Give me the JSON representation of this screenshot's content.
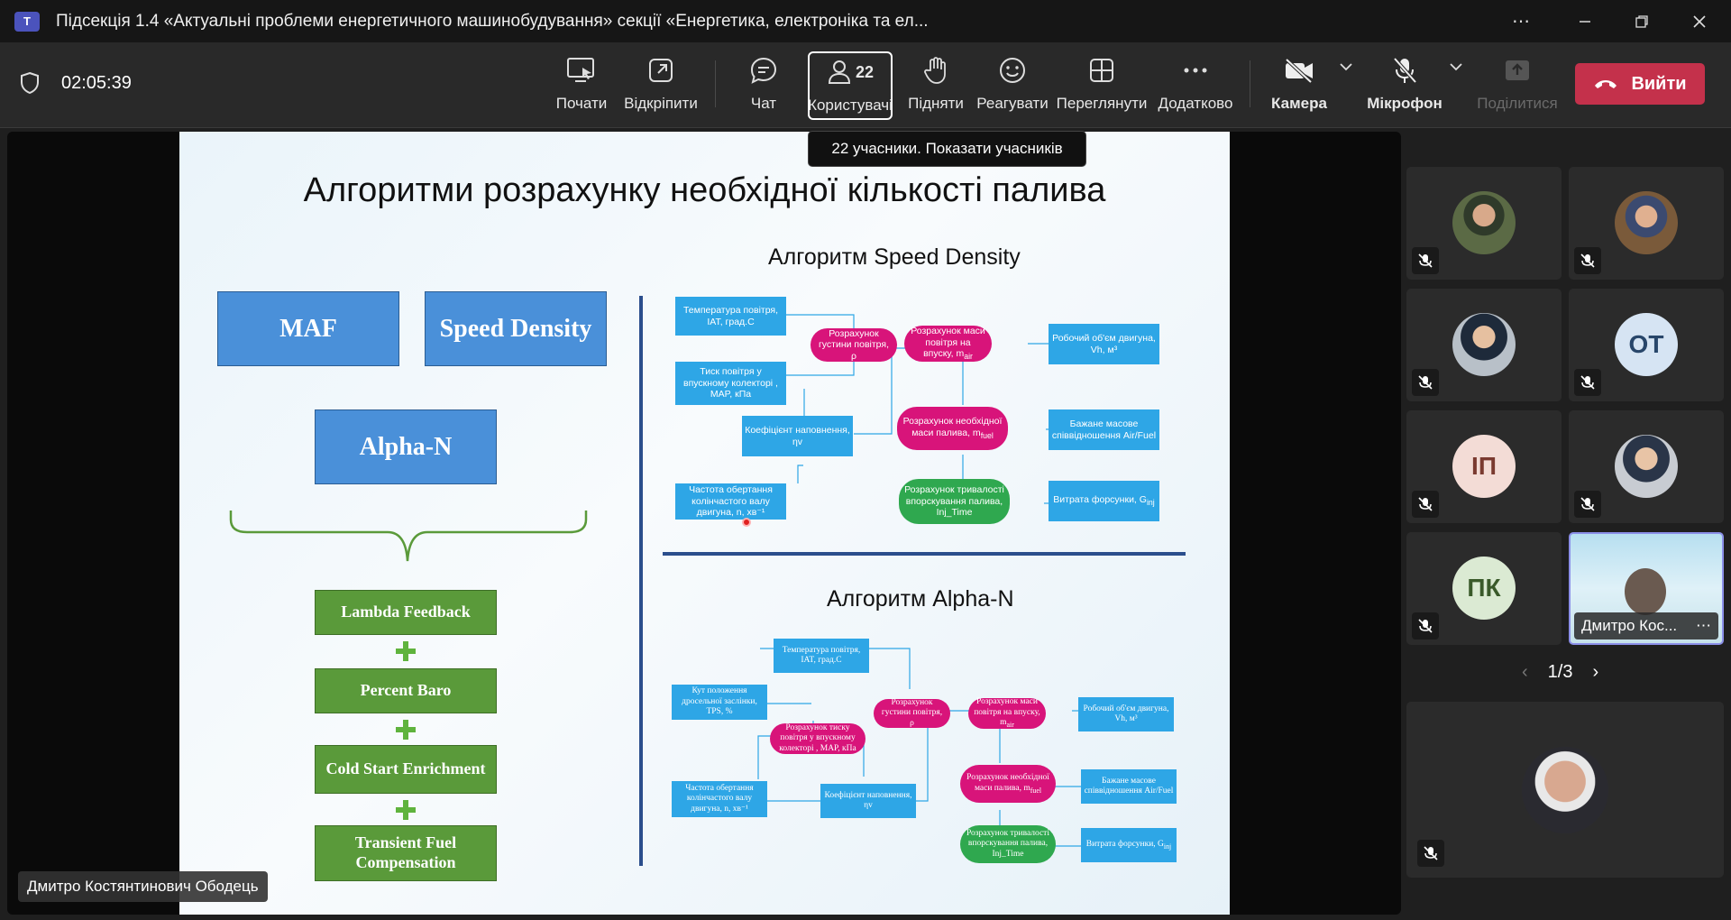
{
  "window": {
    "title": "Підсекція 1.4 «Актуальні проблеми енергетичного машинобудування» секції «Енергетика, електроніка та ел...",
    "app_logo": "T"
  },
  "meeting": {
    "timer": "02:05:39",
    "participant_count": "22",
    "tooltip": "22 учасники. Показати учасників"
  },
  "toolbar": {
    "start": "Почати",
    "popout": "Відкріпити",
    "chat": "Чат",
    "people": "Користувачі",
    "raise": "Підняти",
    "react": "Реагувати",
    "view": "Переглянути",
    "more": "Додатково",
    "camera": "Камера",
    "mic": "Мікрофон",
    "share": "Поділитися",
    "leave": "Вийти"
  },
  "slide": {
    "title": "Алгоритми розрахунку необхідної кількості палива",
    "boxes": {
      "maf": "MAF",
      "speed_density": "Speed Density",
      "alpha_n": "Alpha-N"
    },
    "corrections": [
      "Lambda Feedback",
      "Percent Baro",
      "Cold Start Enrichment",
      "Transient Fuel Compensation"
    ],
    "sd": {
      "title": "Алгоритм Speed Density",
      "temp": "Температура повітря, IAT, град.С",
      "pressure": "Тиск повітря у впускному колекторі , MAP, кПа",
      "rpm": "Частота обертання колінчастого валу двигуна, n, хв⁻¹",
      "density": "Розрахунок густини повітря, ρ",
      "efficiency": "Коефіцієнт наповнення, ηv",
      "air_mass": "Розрахунок маси повітря на впуску, m",
      "air_mass_sub": "air",
      "volume": "Робочий об'єм двигуна, Vh, м³",
      "fuel_mass": "Розрахунок необхідної маси палива, m",
      "fuel_mass_sub": "fuel",
      "afr": "Бажане масове співвідношення Air/Fuel",
      "inj_time": "Розрахунок тривалості впорскування палива, Inj_Time",
      "injector": "Витрата форсунки, G",
      "injector_sub": "inj"
    },
    "an": {
      "title": "Алгоритм Alpha-N",
      "temp": "Температура повітря, IAT, град.С",
      "tps": "Кут положення дросельної заслінки, TPS, %",
      "map_calc": "Розрахунок тиску повітря у впускному колекторі , MAP, кПа",
      "rpm": "Частота обертання колінчастого валу двигуна, n, хв⁻¹",
      "density": "Розрахунок густини повітря, ρ",
      "efficiency": "Коефіцієнт наповнення, ηv",
      "air_mass": "Розрахунок маси повітря на впуску, m",
      "air_mass_sub": "air",
      "volume": "Робочий об'єм двигуна, Vh, м³",
      "fuel_mass": "Розрахунок необхідної маси палива, m",
      "fuel_mass_sub": "fuel",
      "afr": "Бажане масове співвідношення Air/Fuel",
      "inj_time": "Розрахунок тривалості впорскування палива, Inj_Time",
      "injector": "Витрата форсунки, G",
      "injector_sub": "inj"
    }
  },
  "presenter_name": "Дмитро Костянтинович Ободець",
  "participants": {
    "initials": [
      "ОТ",
      "ІП",
      "ПК"
    ],
    "self_name": "Дмитро Кос...",
    "page": "1/3"
  },
  "colors": {
    "accent": "#4b53bc",
    "leave": "#c4314b",
    "mic_muted": "#ffffff"
  }
}
